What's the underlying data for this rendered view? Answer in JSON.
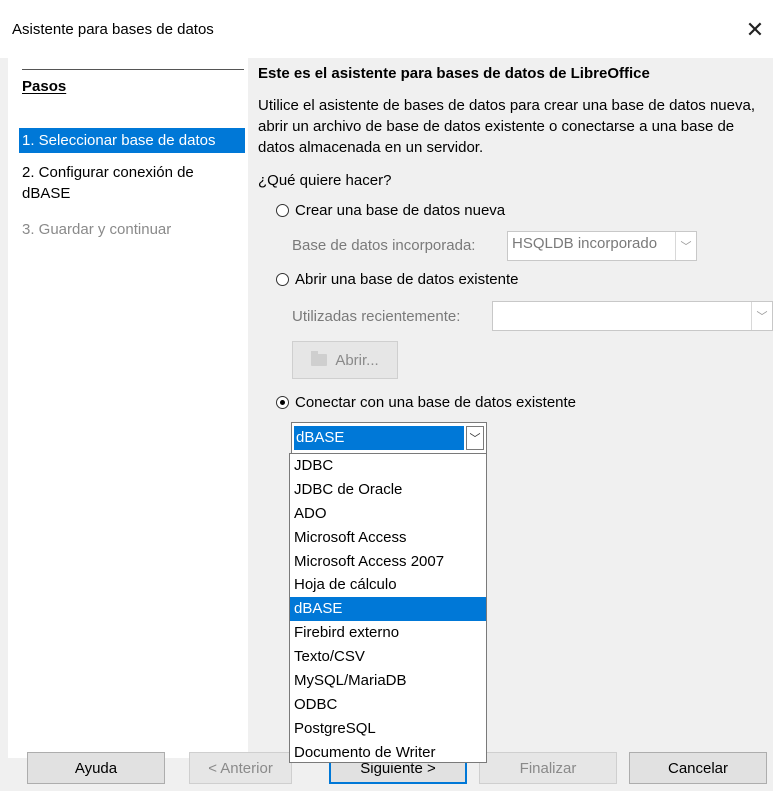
{
  "window": {
    "title": "Asistente para bases de datos",
    "close_glyph": "✕"
  },
  "sidebar": {
    "title": "Pasos",
    "steps": [
      {
        "label": "1. Seleccionar base de datos",
        "state": "selected"
      },
      {
        "label": "2. Configurar conexión de dBASE",
        "state": "normal"
      },
      {
        "label": "3. Guardar y continuar",
        "state": "disabled"
      }
    ]
  },
  "main": {
    "heading": "Este es el asistente para bases de datos de LibreOffice",
    "description": "Utilice el asistente de bases de datos para crear una base de datos nueva, abrir un archivo de base de datos existente o conectarse a una base de datos almacenada en un servidor.",
    "question": "¿Qué quiere hacer?",
    "options": {
      "create": {
        "label": "Crear una base de datos nueva",
        "checked": false
      },
      "embedded_label": "Base de datos incorporada:",
      "embedded_value": "HSQLDB incorporado",
      "open": {
        "label": "Abrir una base de datos existente",
        "checked": false
      },
      "recent_label": "Utilizadas recientemente:",
      "recent_value": "",
      "open_button": "Abrir...",
      "connect": {
        "label": "Conectar con una base de datos existente",
        "checked": true
      }
    },
    "connection_type": {
      "selected": "dBASE",
      "options": [
        "JDBC",
        "JDBC de Oracle",
        "ADO",
        "Microsoft Access",
        "Microsoft Access 2007",
        "Hoja de cálculo",
        "dBASE",
        "Firebird externo",
        "Texto/CSV",
        "MySQL/MariaDB",
        "ODBC",
        "PostgreSQL",
        "Documento de Writer"
      ]
    }
  },
  "buttons": {
    "help": "Ayuda",
    "back": "< Anterior",
    "next": "Siguiente >",
    "finish": "Finalizar",
    "cancel": "Cancelar"
  },
  "colors": {
    "accent": "#0078d7",
    "disabled": "#8a8a8a"
  }
}
